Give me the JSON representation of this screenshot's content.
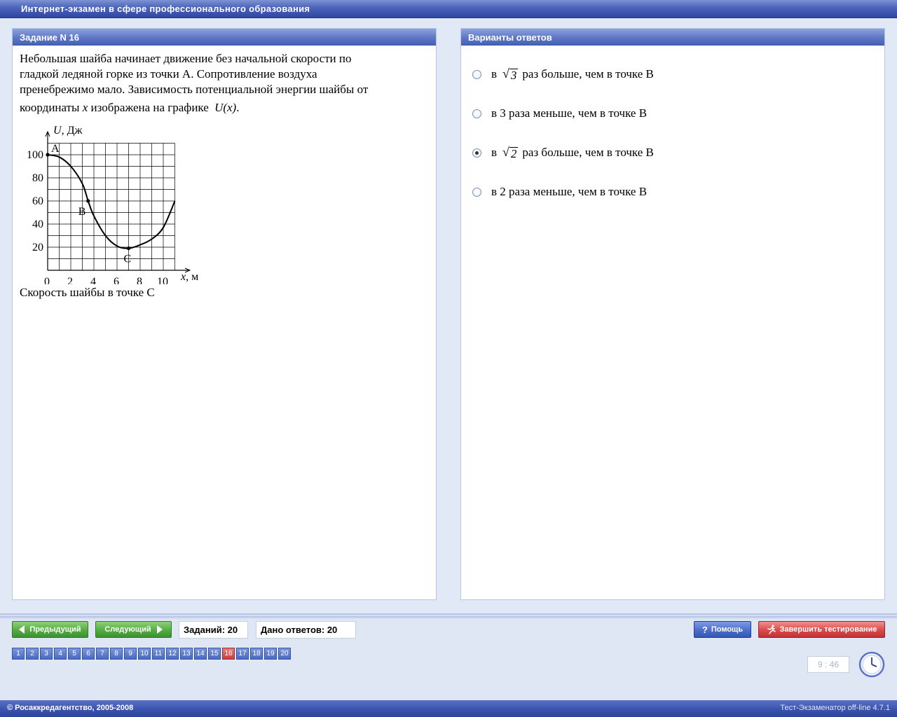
{
  "window": {
    "title": "Интернет-экзамен в сфере профессионального образования"
  },
  "task": {
    "header": "Задание N 16",
    "question_lines": [
      "Небольшая шайба начинает движение без начальной скорости по",
      "гладкой ледяной горке из точки А. Сопротивление воздуха",
      "пренебрежимо мало. Зависимость потенциальной энергии шайбы от"
    ],
    "question_line4_prefix": "координаты",
    "question_line4_var": "x",
    "question_line4_mid": "изображена на графике",
    "question_line4_func": "U(x)",
    "question_line4_end": ".",
    "question_tail": "Скорость шайбы в точке С"
  },
  "chart_data": {
    "type": "line",
    "ylabel": "U, Дж",
    "xlabel": "x, м",
    "xlim": [
      0,
      11
    ],
    "ylim": [
      0,
      110
    ],
    "xticks": [
      "0",
      "2",
      "4",
      "6",
      "8",
      "10"
    ],
    "yticks": [
      "20",
      "40",
      "60",
      "80",
      "100"
    ],
    "x": [
      0,
      1,
      2,
      3,
      3.5,
      4,
      5,
      6,
      7,
      8,
      9,
      10,
      11
    ],
    "y": [
      100,
      98,
      90,
      75,
      60,
      47,
      30,
      21,
      19,
      22,
      27,
      37,
      60
    ],
    "points": [
      {
        "label": "A",
        "x": 0,
        "y": 100
      },
      {
        "label": "B",
        "x": 3.5,
        "y": 60
      },
      {
        "label": "C",
        "x": 7,
        "y": 19
      }
    ],
    "grid": true
  },
  "answers": {
    "header": "Варианты ответов",
    "selected_index": 2,
    "options": [
      {
        "prefix": "в",
        "radicand": "3",
        "suffix": "раз больше, чем в точке В"
      },
      {
        "prefix": "в 3 раза меньше, чем в точке В",
        "radicand": "",
        "suffix": ""
      },
      {
        "prefix": "в",
        "radicand": "2",
        "suffix": "раз больше, чем в точке В"
      },
      {
        "prefix": "в 2 раза меньше, чем в точке В",
        "radicand": "",
        "suffix": ""
      }
    ]
  },
  "nav": {
    "prev_label": "Предыдущий",
    "next_label": "Следующий",
    "tasks_count": "Заданий: 20",
    "answers_given": "Дано ответов: 20",
    "help_label": "Помощь",
    "finish_label": "Завершить тестирование",
    "pages": [
      "1",
      "2",
      "3",
      "4",
      "5",
      "6",
      "7",
      "8",
      "9",
      "10",
      "11",
      "12",
      "13",
      "14",
      "15",
      "16",
      "17",
      "18",
      "19",
      "20"
    ],
    "current_page": "16",
    "timer": "9 : 46"
  },
  "footer": {
    "copyright": "© Росаккредагентство, 2005-2008",
    "version": "Тест-Экзаменатор off-line 4.7.1"
  },
  "colors": {
    "header_blue": "#4a62b8",
    "button_green": "#54ad42",
    "button_blue": "#4d6dcc",
    "button_red": "#d94a4a",
    "current_page": "#c94040"
  }
}
